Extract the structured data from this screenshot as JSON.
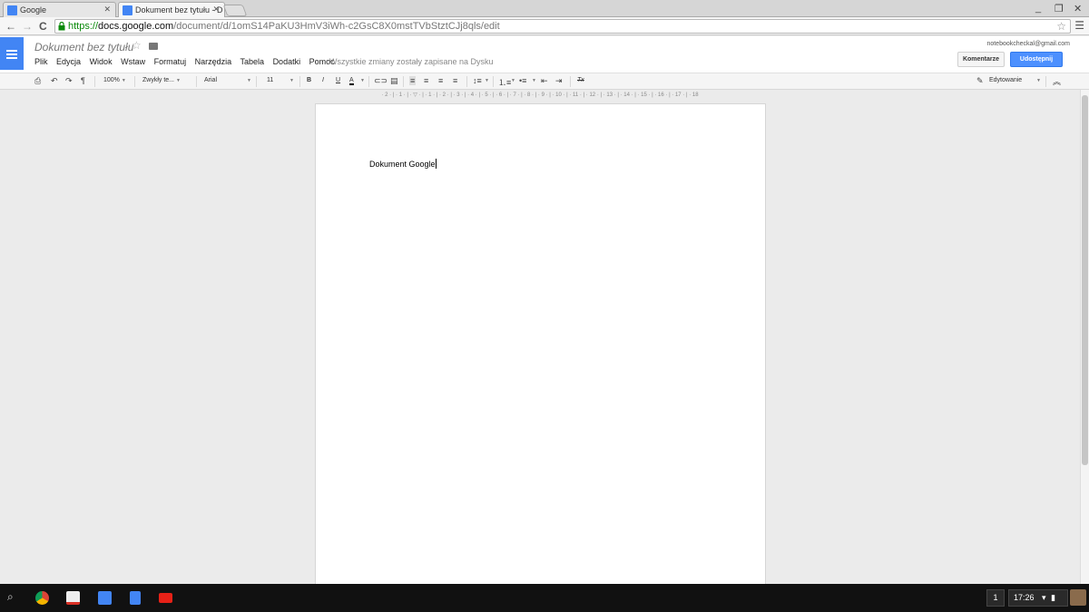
{
  "browser": {
    "tabs": [
      {
        "label": "Google",
        "active": false
      },
      {
        "label": "Dokument bez tytułu - D",
        "active": true
      }
    ],
    "url_scheme": "https://",
    "url_host": "docs.google.com",
    "url_path": "/document/d/1omS14PaKU3HmV3iWh-c2GsC8X0mstTVbStztCJj8qls/edit",
    "back_icon": "←",
    "forward_icon": "→",
    "reload_icon": "C",
    "star_icon": "☆",
    "menu_icon": "☰",
    "minimize_icon": "_",
    "restore_icon": "❐",
    "close_icon": "✕"
  },
  "docs": {
    "title": "Dokument bez tytułu",
    "title_star": "☆",
    "menu": [
      "Plik",
      "Edycja",
      "Widok",
      "Wstaw",
      "Formatuj",
      "Narzędzia",
      "Tabela",
      "Dodatki",
      "Pomoc"
    ],
    "save_status": "Wszystkie zmiany zostały zapisane na Dysku",
    "account": "notebookcheckal@gmail.com",
    "comments_button": "Komentarze",
    "share_button": "Udostępnij"
  },
  "toolbar": {
    "zoom": "100%",
    "style": "Zwykły te...",
    "font": "Arial",
    "size": "11",
    "bold": "B",
    "italic": "I",
    "underline": "U",
    "text_color": "A",
    "clear_format": "Tx",
    "mode": "Edytowanie",
    "collapse": "︽"
  },
  "ruler": "· 2 · | · 1 · | · ▽ · | · 1 · | · 2 · | · 3 · | · 4 · | · 5 · | · 6 · | · 7 · | · 8 · | · 9 · | · 10 · | · 11 · | · 12 · | · 13 · | · 14 · | · 15 · | · 16 · | · 17 · | · 18",
  "document": {
    "text": "Dokument Google"
  },
  "shelf": {
    "tray_count": "1",
    "clock": "17:26"
  },
  "colors": {
    "docs_blue": "#4285f4",
    "share_blue": "#4d90fe",
    "secure_green": "#0a8a0a"
  }
}
